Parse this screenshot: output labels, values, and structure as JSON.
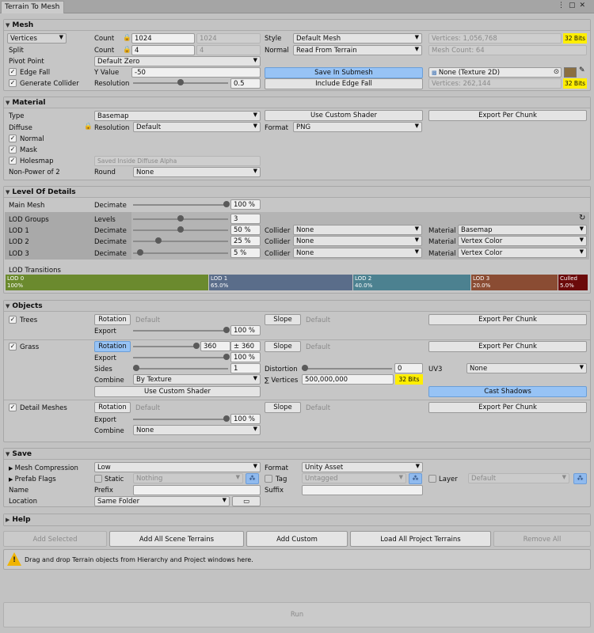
{
  "window": {
    "title": "Terrain To Mesh"
  },
  "mesh": {
    "header": "Mesh",
    "vertices_dd": "Vertices",
    "split_label": "Split",
    "count_label": "Count",
    "count_value": "1024",
    "count_dim": "1024",
    "split_count_label": "Count",
    "split_count_value": "4",
    "split_count_dim": "4",
    "style_label": "Style",
    "style_value": "Default Mesh",
    "normal_label": "Normal",
    "normal_value": "Read From Terrain",
    "vertices_info": "Vertices: 1,056,768",
    "bits1": "32 Bits",
    "mesh_count": "Mesh Count: 64",
    "pivot_label": "Pivot Point",
    "pivot_value": "Default Zero",
    "edge_fall_label": "Edge Fall",
    "yvalue_label": "Y Value",
    "yvalue": "-50",
    "save_submesh": "Save In Submesh",
    "texture": "None (Texture 2D)",
    "gen_collider_label": "Generate Collider",
    "resolution_label": "Resolution",
    "resolution_value": "0.5",
    "include_edge": "Include Edge Fall",
    "vertices_info2": "Vertices: 262,144",
    "bits2": "32 Bits"
  },
  "material": {
    "header": "Material",
    "type_label": "Type",
    "type_value": "Basemap",
    "custom_shader": "Use Custom Shader",
    "export_chunk": "Export Per Chunk",
    "diffuse_label": "Diffuse",
    "resolution_label": "Resolution",
    "resolution_value": "Default",
    "format_label": "Format",
    "format_value": "PNG",
    "normal_label": "Normal",
    "mask_label": "Mask",
    "holesmap_label": "Holesmap",
    "holes_info": "Saved Inside Diffuse Alpha",
    "npot_label": "Non-Power of 2",
    "round_label": "Round",
    "round_value": "None"
  },
  "lod": {
    "header": "Level Of Details",
    "main_mesh": "Main Mesh",
    "decimate": "Decimate",
    "main_value": "100 %",
    "groups_label": "LOD Groups",
    "levels_label": "Levels",
    "levels_value": "3",
    "rows": [
      {
        "name": "LOD 1",
        "decimate": "Decimate",
        "value": "50 %",
        "collider_label": "Collider",
        "collider": "None",
        "material_label": "Material",
        "material": "Basemap"
      },
      {
        "name": "LOD 2",
        "decimate": "Decimate",
        "value": "25 %",
        "collider_label": "Collider",
        "collider": "None",
        "material_label": "Material",
        "material": "Vertex Color"
      },
      {
        "name": "LOD 3",
        "decimate": "Decimate",
        "value": "5 %",
        "collider_label": "Collider",
        "collider": "None",
        "material_label": "Material",
        "material": "Vertex Color"
      }
    ],
    "transitions_label": "LOD Transitions",
    "transitions": [
      {
        "name": "LOD 0",
        "pct": "100%",
        "color": "#6b8a2e"
      },
      {
        "name": "LOD 1",
        "pct": "65.0%",
        "color": "#5a6d8a"
      },
      {
        "name": "LOD 2",
        "pct": "40.0%",
        "color": "#4c8190"
      },
      {
        "name": "LOD 3",
        "pct": "20.0%",
        "color": "#8a4c33"
      },
      {
        "name": "Culled",
        "pct": "5.0%",
        "color": "#6b0a0a"
      }
    ]
  },
  "objects": {
    "header": "Objects",
    "trees": {
      "label": "Trees",
      "rotation": "Rotation",
      "rotation_info": "Default",
      "export_label": "Export",
      "export_value": "100 %",
      "slope": "Slope",
      "slope_info": "Default",
      "export_chunk": "Export Per Chunk"
    },
    "grass": {
      "label": "Grass",
      "rotation": "Rotation",
      "rot_value": "360",
      "rot_range": "± 360",
      "slope": "Slope",
      "slope_info": "Default",
      "export_chunk": "Export Per Chunk",
      "export_label": "Export",
      "export_value": "100 %",
      "sides_label": "Sides",
      "sides_value": "1",
      "distortion_label": "Distortion",
      "distortion_value": "0",
      "uv3_label": "UV3",
      "uv3_value": "None",
      "combine_label": "Combine",
      "combine_value": "By Texture",
      "vertices_label": "∑ Vertices",
      "vertices_value": "500,000,000",
      "bits": "32 Bits",
      "custom_shader": "Use Custom Shader",
      "cast_shadows": "Cast Shadows"
    },
    "detail": {
      "label": "Detail Meshes",
      "rotation": "Rotation",
      "rotation_info": "Default",
      "slope": "Slope",
      "slope_info": "Default",
      "export_chunk": "Export Per Chunk",
      "export_label": "Export",
      "export_value": "100 %",
      "combine_label": "Combine",
      "combine_value": "None"
    }
  },
  "save": {
    "header": "Save",
    "compression_label": "Mesh Compression",
    "compression_value": "Low",
    "format_label": "Format",
    "format_value": "Unity Asset",
    "prefab_label": "Prefab Flags",
    "static_label": "Static",
    "static_value": "Nothing",
    "tag_label": "Tag",
    "tag_value": "Untagged",
    "layer_label": "Layer",
    "layer_value": "Default",
    "name_label": "Name",
    "prefix_label": "Prefix",
    "suffix_label": "Suffix",
    "location_label": "Location",
    "location_value": "Same Folder"
  },
  "help": {
    "header": "Help"
  },
  "actions": {
    "add_selected": "Add Selected",
    "add_all": "Add All Scene Terrains",
    "add_custom": "Add Custom",
    "load_all": "Load All Project Terrains",
    "remove_all": "Remove All"
  },
  "notice": "Drag and drop Terrain objects from Hierarchy and Project windows here.",
  "run": "Run"
}
